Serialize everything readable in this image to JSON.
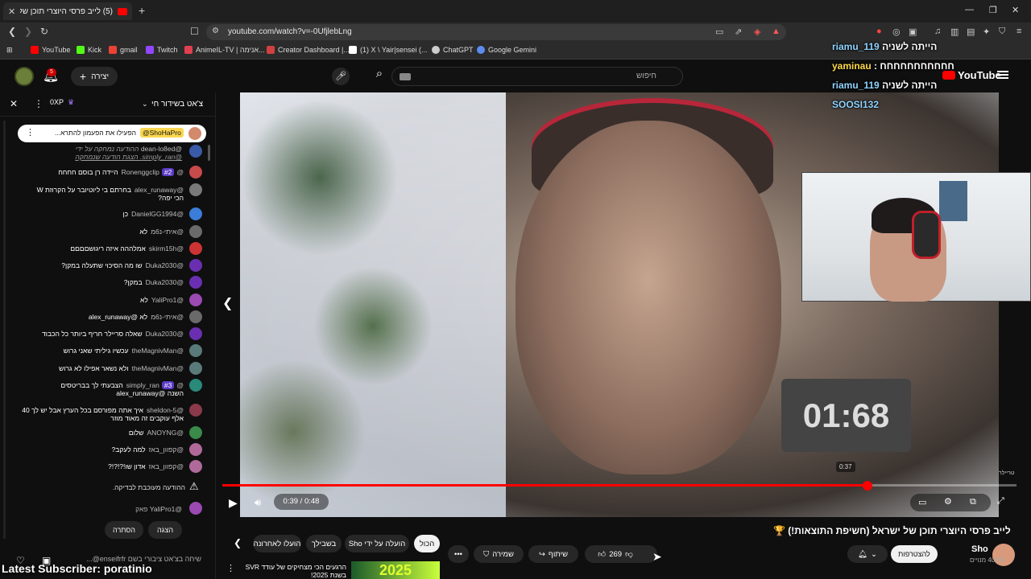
{
  "browser": {
    "tab_title": "(5) לייב פרסי היוצרי תוכן של ישר",
    "url": "youtube.com/watch?v=-0UfjlebLng",
    "bookmarks": [
      {
        "label": "YouTube",
        "color": "#ff0000"
      },
      {
        "label": "Kick",
        "color": "#53fc18"
      },
      {
        "label": "gmail",
        "color": "#ea4335"
      },
      {
        "label": "Twitch",
        "color": "#9146ff"
      },
      {
        "label": "AnimeIL-TV | אנימה...",
        "color": "#e04050"
      },
      {
        "label": "Creator Dashboard |...",
        "color": "#d04040"
      },
      {
        "label": "(1) X \\ Yair|sensei (...",
        "color": "#ffffff"
      },
      {
        "label": "ChatGPT",
        "color": "#cccccc"
      },
      {
        "label": "Google Gemini",
        "color": "#5b8def"
      }
    ]
  },
  "header": {
    "search_placeholder": "חיפוש",
    "create_label": "יצירה",
    "notif_count": "5",
    "logo": "YouTube"
  },
  "overlay_chat": [
    {
      "user": "riamu_119",
      "text": "הייתה לשניה"
    },
    {
      "user": "yaminau",
      "text": "חחחחחחחחחחח"
    },
    {
      "user": "riamu_119",
      "text": "הייתה לשניה"
    },
    {
      "user": "SOOSI132",
      "text": ""
    }
  ],
  "chat": {
    "title": "צ'אט בשידור חי",
    "xp": "0XP",
    "pinned": {
      "author": "@ShoHaPro",
      "text": "הפעילו את הפעמון להתרא..."
    },
    "notice": {
      "author": "@dean-lo8ed",
      "line1": "ההודעה נמחקה על ידי",
      "line2": "@simply_ran. הצגת הודעה שנמחקה"
    },
    "messages": [
      {
        "author": "@Ronenggclip",
        "text": "היידה רן בוסם חחחח",
        "badge": "#2",
        "color": "#c94a4a"
      },
      {
        "author": "@alex_runaway",
        "text": "בחרתם בי ליוטיובר על הקרוזת W",
        "text2": "הכי יפה?",
        "color": "#7a7a7a"
      },
      {
        "author": "@DanielGG1994",
        "text": "כן",
        "color": "#3b7dd8"
      },
      {
        "author": "@איתי-נ6מ",
        "text": "לא",
        "color": "#6a6a6a"
      },
      {
        "author": "@skirm15h",
        "text": "אמלההה איזה ריגושםםםם",
        "color": "#c33"
      },
      {
        "author": "@Duka2030",
        "text": "שו מה הסיכוי שתעלה במקן?",
        "color": "#6a2fb0"
      },
      {
        "author": "@Duka2030",
        "text": "במקן?",
        "color": "#6a2fb0"
      },
      {
        "author": "@YaliPro1",
        "text": "לא",
        "color": "#9a4ab0"
      },
      {
        "author": "@איתי-נ6מ",
        "text": "לא @alex_runaway",
        "color": "#6a6a6a"
      },
      {
        "author": "@Duka2030",
        "text": "שאלה סריילר חריף ביותר כל הכבוד",
        "color": "#6a2fb0"
      },
      {
        "author": "@theMagnivMan",
        "text": "עכשיו גיליתי שאני גרוש",
        "color": "#5a7a7a"
      },
      {
        "author": "@theMagnivMan",
        "text": "ולא נשאר אפילו לא גרוש",
        "color": "#5a7a7a"
      },
      {
        "author": "@simply_ran",
        "text": "הצבעתי לך בבריטסים",
        "text2": "השנה @alex_runaway",
        "badge": "#3",
        "color": "#2a8a7a"
      },
      {
        "author": "@sheldon-5",
        "text": "איך אתה מפורסם בכל הערץ אבל יש לך 40",
        "text2": "אלף עוקבים זה מאוד מוזר",
        "color": "#8a3a4a"
      },
      {
        "author": "@ANOYNG",
        "text": "שלום",
        "color": "#3a8a4a"
      },
      {
        "author": "@קפוון_באז",
        "text": "למה לעקב?",
        "color": "#b06a9a"
      },
      {
        "author": "@קפוון_באז",
        "text": "אדון שו!?!?!?",
        "color": "#b06a9a"
      }
    ],
    "review_notice": "ההודעה מעוכבת לבדיקה.",
    "review_user": "@YaliPro1",
    "review_text": "פאק",
    "btn_show": "הצגה",
    "btn_hide": "הסתרה",
    "input_placeholder": "שיחה בצ'אט ציבורי בשם enseifrfr@..."
  },
  "player": {
    "time_current": "0:39",
    "time_sep": "/",
    "time_total": "0:48",
    "progress": 0.8125,
    "preview_text": "01:68",
    "preview_time": "0:37",
    "side_label": "טריילר"
  },
  "below": {
    "title": "לייב פרסי היוצרי תוכן של ישראל (חשיפת התוצאות!) 🏆",
    "channel": "Sho",
    "subs": "40.6K מנויים",
    "subscribe": "להצטרפות",
    "likes": "269",
    "share": "שיתוף",
    "save": "שמירה",
    "filters": [
      "הכול",
      "הועלה על ידי Sho",
      "בשבילך",
      "הועלו לאחרונה"
    ],
    "rec_title": "הרגעים הכי מצחיקים של עודד SVR",
    "rec_title2": "בשנת 2025!",
    "rec_thumb": "2025"
  },
  "overlay_bottom": "Latest Subscriber: poratinio"
}
